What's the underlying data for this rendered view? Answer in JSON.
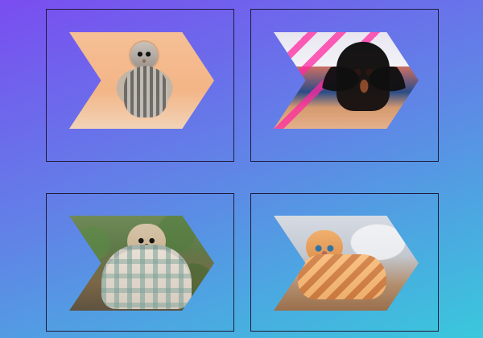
{
  "gallery": {
    "cards": [
      {
        "id": "cat"
      },
      {
        "id": "dog"
      },
      {
        "id": "pug"
      },
      {
        "id": "kitten"
      }
    ]
  }
}
